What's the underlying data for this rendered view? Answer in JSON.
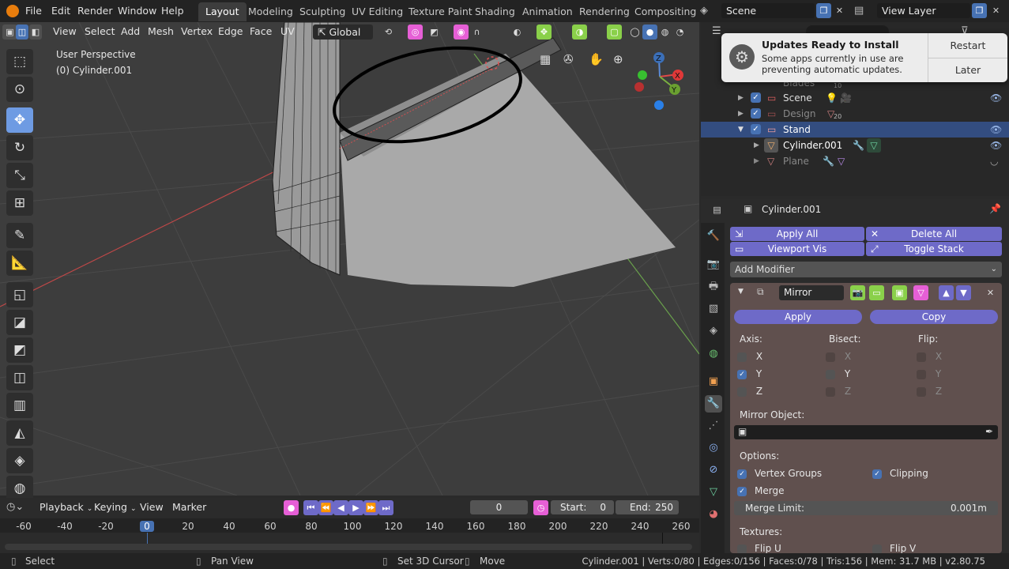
{
  "menubar": {
    "items": [
      "File",
      "Edit",
      "Render",
      "Window",
      "Help"
    ]
  },
  "workspaces": [
    "Layout",
    "Modeling",
    "Sculpting",
    "UV Editing",
    "Texture Paint",
    "Shading",
    "Animation",
    "Rendering",
    "Compositing"
  ],
  "scene": {
    "name": "Scene"
  },
  "view_layer": {
    "name": "View Layer"
  },
  "viewport": {
    "menus": [
      "View",
      "Select",
      "Add",
      "Mesh",
      "Vertex",
      "Edge",
      "Face",
      "UV"
    ],
    "transform_orientation": "Global",
    "overlay_label": "User Perspective",
    "object_label": "(0) Cylinder.001"
  },
  "notification": {
    "title": "Updates Ready to Install",
    "body_line1": "Some apps currently in use are",
    "body_line2": "preventing automatic updates.",
    "restart_label": "Restart",
    "later_label": "Later"
  },
  "outliner": {
    "rows": [
      {
        "name": "Blades",
        "num": "10"
      },
      {
        "name": "Scene"
      },
      {
        "name": "Design",
        "num": "20"
      },
      {
        "name": "Stand"
      },
      {
        "name": "Cylinder.001"
      },
      {
        "name": "Plane"
      }
    ]
  },
  "properties": {
    "object_name": "Cylinder.001",
    "apply_all": "Apply All",
    "delete_all": "Delete All",
    "viewport_vis": "Viewport Vis",
    "toggle_stack": "Toggle Stack",
    "add_modifier": "Add Modifier",
    "modifier": {
      "name": "Mirror",
      "apply": "Apply",
      "copy": "Copy",
      "axis_label": "Axis:",
      "bisect_label": "Bisect:",
      "flip_label": "Flip:",
      "x": "X",
      "y": "Y",
      "z": "Z",
      "mirror_object_label": "Mirror Object:",
      "options_label": "Options:",
      "vertex_groups": "Vertex Groups",
      "clipping": "Clipping",
      "merge": "Merge",
      "merge_limit_label": "Merge Limit:",
      "merge_limit_value": "0.001m",
      "textures_label": "Textures:",
      "flip_u": "Flip U",
      "flip_v": "Flip V"
    }
  },
  "timeline": {
    "menus": [
      "Playback",
      "Keying",
      "View",
      "Marker"
    ],
    "current_frame": "0",
    "start_label": "Start:",
    "start_value": "0",
    "end_label": "End:",
    "end_value": "250",
    "ticks": [
      "-60",
      "-40",
      "-20",
      "0",
      "20",
      "40",
      "60",
      "80",
      "100",
      "120",
      "140",
      "160",
      "180",
      "200",
      "220",
      "240",
      "260"
    ]
  },
  "statusbar": {
    "select": "Select",
    "pan_view": "Pan View",
    "set_cursor": "Set 3D Cursor",
    "move": "Move",
    "stats": "Cylinder.001 | Verts:0/80 | Edges:0/156 | Faces:0/78 | Tris:156 | Mem: 31.7 MB | v2.80.75"
  },
  "colors": {
    "accent": "#4772b3",
    "purple": "#6e6ac8",
    "modifier_bg": "#60504e"
  }
}
